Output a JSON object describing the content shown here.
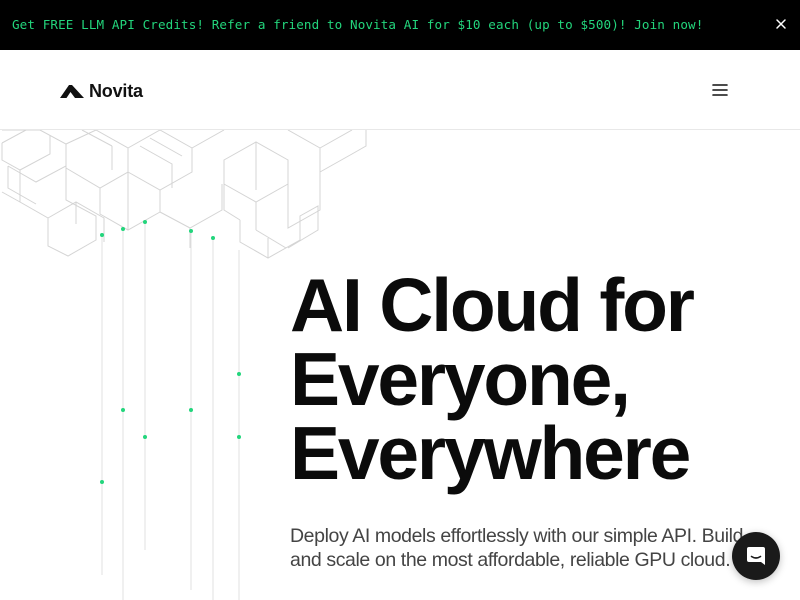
{
  "promo": {
    "text": "Get FREE LLM API Credits! Refer a friend to Novita AI for $10 each (up to $500)! Join now!",
    "close_icon": "close-icon"
  },
  "header": {
    "logo_text": "Novita",
    "logo_icon": "novita-logo-mark",
    "menu_icon": "hamburger-menu-icon"
  },
  "hero": {
    "title_lines": [
      "AI Cloud for",
      "Everyone,",
      "Everywhere"
    ],
    "subtitle_lines": [
      "Deploy AI models effortlessly with our simple API. Build",
      "and scale on the most affordable, reliable GPU cloud."
    ]
  },
  "chat": {
    "icon": "chat-bubble-icon"
  },
  "colors": {
    "accent": "#23d57c",
    "promo_bg": "#000000",
    "text": "#0b0b0b",
    "subtext": "#444444"
  }
}
